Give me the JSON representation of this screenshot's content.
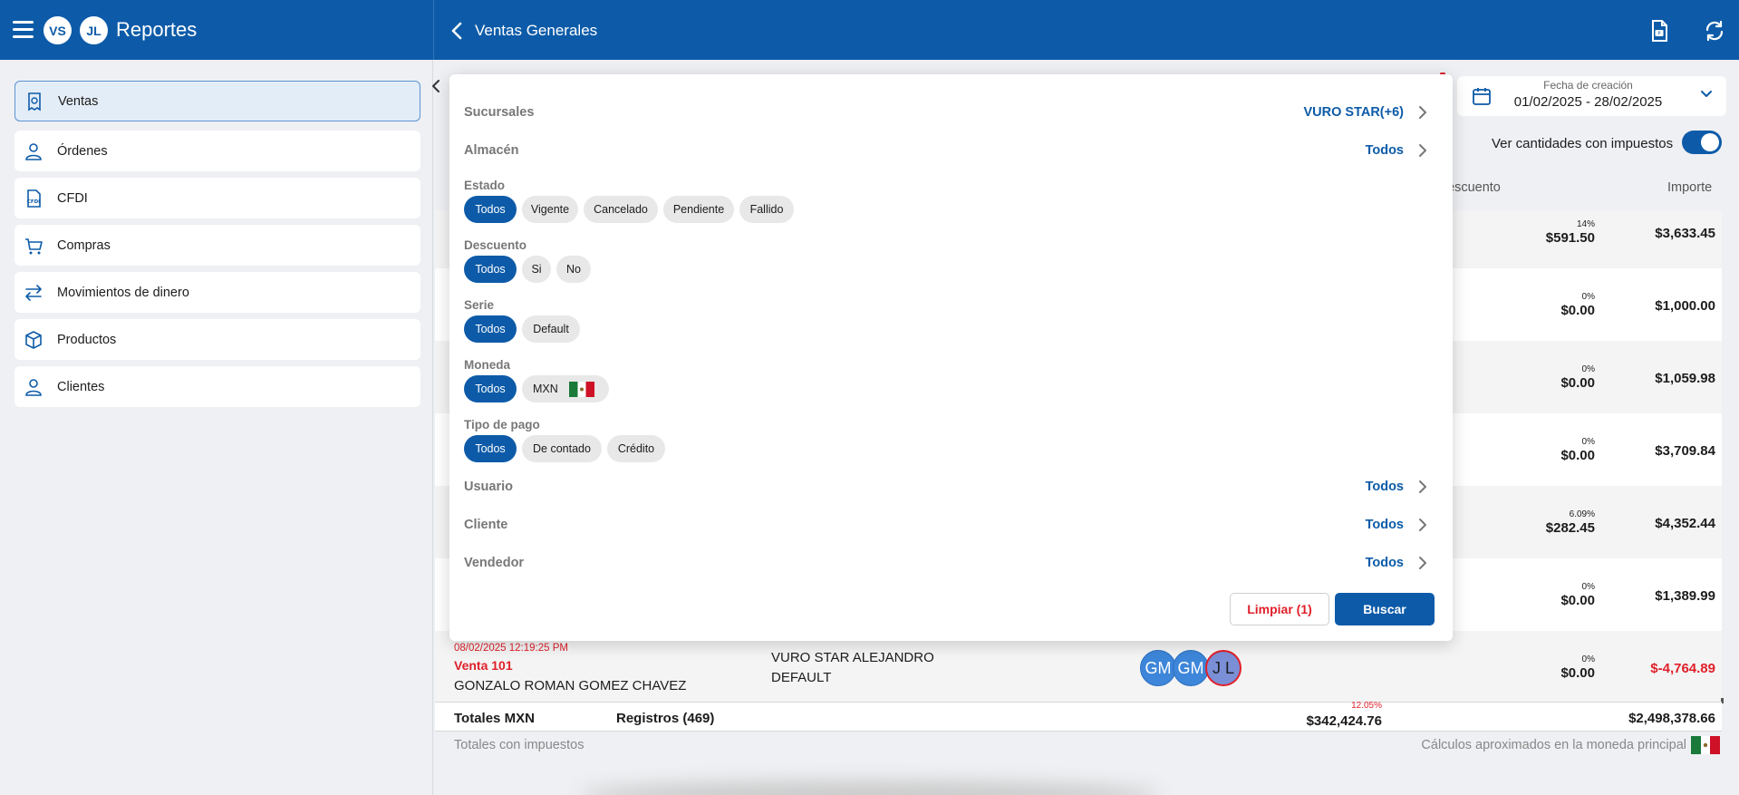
{
  "header": {
    "app_title": "Reportes",
    "avatars": [
      "VS",
      "JL"
    ],
    "page_title": "Ventas Generales",
    "icons": [
      "menu-icon",
      "back-icon",
      "export-pdf-icon",
      "refresh-icon"
    ]
  },
  "sidebar": {
    "items": [
      {
        "label": "Ventas",
        "icon": "receipt-icon",
        "active": true
      },
      {
        "label": "Órdenes",
        "icon": "person-icon",
        "active": false
      },
      {
        "label": "CFDI",
        "icon": "cfdi-icon",
        "active": false
      },
      {
        "label": "Compras",
        "icon": "cart-icon",
        "active": false
      },
      {
        "label": "Movimientos de dinero",
        "icon": "transfer-icon",
        "active": false
      },
      {
        "label": "Productos",
        "icon": "box-icon",
        "active": false
      },
      {
        "label": "Clientes",
        "icon": "person-icon",
        "active": false
      }
    ]
  },
  "date_filter": {
    "label": "Fecha de creación",
    "value": "01/02/2025 - 28/02/2025"
  },
  "tax_toggle": {
    "label": "Ver cantidades con impuestos",
    "on": true
  },
  "table": {
    "headers": {
      "discount": "escuento",
      "amount": "Importe"
    },
    "rows": [
      {
        "pct": "14%",
        "discount": "$591.50",
        "amount": "$3,633.45",
        "negative": false
      },
      {
        "pct": "0%",
        "discount": "$0.00",
        "amount": "$1,000.00",
        "negative": false
      },
      {
        "pct": "0%",
        "discount": "$0.00",
        "amount": "$1,059.98",
        "negative": false
      },
      {
        "pct": "0%",
        "discount": "$0.00",
        "amount": "$3,709.84",
        "negative": false
      },
      {
        "pct": "6.09%",
        "discount": "$282.45",
        "amount": "$4,352.44",
        "negative": false
      },
      {
        "pct": "0%",
        "discount": "$0.00",
        "amount": "$1,389.99",
        "negative": false
      }
    ],
    "last_row": {
      "date": "08/02/2025 12:19:25 PM",
      "folio": "Venta 101",
      "client": "GONZALO ROMAN GOMEZ CHAVEZ",
      "branch": "VURO STAR ALEJANDRO",
      "serie": "DEFAULT",
      "avatars": [
        "GM",
        "GM",
        "J L"
      ],
      "pct": "0%",
      "discount": "$0.00",
      "amount": "$-4,764.89"
    }
  },
  "totals": {
    "label": "Totales MXN",
    "records": "Registros (469)",
    "discount_pct": "12.05%",
    "discount": "$342,424.76",
    "amount": "$2,498,378.66",
    "footer_left": "Totales con impuestos",
    "footer_right": "Cálculos aproximados en la moneda principal"
  },
  "filters": {
    "sucursales": {
      "label": "Sucursales",
      "value": "VURO STAR(+6)"
    },
    "almacen": {
      "label": "Almacén",
      "value": "Todos"
    },
    "estado": {
      "label": "Estado",
      "chips": [
        "Todos",
        "Vigente",
        "Cancelado",
        "Pendiente",
        "Fallido"
      ]
    },
    "descuento": {
      "label": "Descuento",
      "chips": [
        "Todos",
        "Si",
        "No"
      ]
    },
    "serie": {
      "label": "Serie",
      "chips": [
        "Todos",
        "Default"
      ]
    },
    "moneda": {
      "label": "Moneda",
      "chips": [
        "Todos",
        "MXN"
      ]
    },
    "tipo_pago": {
      "label": "Tipo de pago",
      "chips": [
        "Todos",
        "De contado",
        "Crédito"
      ]
    },
    "usuario": {
      "label": "Usuario",
      "value": "Todos"
    },
    "cliente": {
      "label": "Cliente",
      "value": "Todos"
    },
    "vendedor": {
      "label": "Vendedor",
      "value": "Todos"
    },
    "clear_label": "Limpiar (1)",
    "search_label": "Buscar"
  },
  "colors": {
    "primary": "#0d5ba8",
    "danger": "#e0202a",
    "chip_bg": "#e8e8e8"
  }
}
